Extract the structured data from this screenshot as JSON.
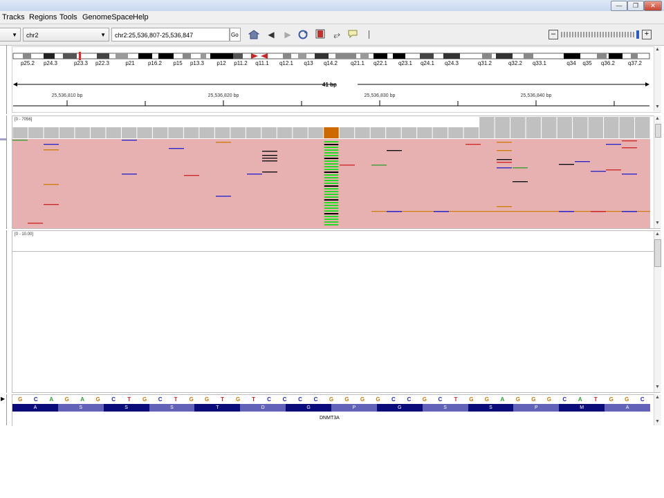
{
  "menubar": {
    "items": [
      "Tracks",
      "Regions",
      "Tools",
      "GenomeSpace",
      "Help"
    ]
  },
  "toolbar": {
    "genome_selector": "",
    "chromosome": "chr2",
    "locus": "chr2:25,536,807-25,536,847",
    "go_label": "Go",
    "icons": [
      "home-icon",
      "back-icon",
      "forward-icon",
      "refresh-icon",
      "region-of-interest-icon",
      "fit-window-icon",
      "popup-info-icon"
    ]
  },
  "window_controls": [
    "minimize-icon",
    "restore-icon",
    "close-icon"
  ],
  "ideogram": {
    "bands": [
      "p25.2",
      "p24.3",
      "p23.3",
      "p22.3",
      "p21",
      "p16.2",
      "p15",
      "p13.3",
      "p12",
      "p11.2",
      "q11.1",
      "q12.1",
      "q13",
      "q14.2",
      "q21.1",
      "q22.1",
      "q23.1",
      "q24.1",
      "q24.3",
      "q31.2",
      "q32.2",
      "q33.1",
      "q34",
      "q35",
      "q36.2",
      "q37.2"
    ]
  },
  "ruler": {
    "span_label": "41 bp",
    "coordinates": [
      "25,536,810 bp",
      "25,536,820 bp",
      "25,536,830 bp",
      "25,536,840 bp"
    ]
  },
  "coverage_track": {
    "range_label": "[0 - 7056]"
  },
  "data_track": {
    "range_label": "[0 - 10.00]"
  },
  "sequence": {
    "bases": [
      "G",
      "C",
      "A",
      "G",
      "A",
      "G",
      "C",
      "T",
      "G",
      "C",
      "T",
      "G",
      "G",
      "T",
      "G",
      "T",
      "C",
      "C",
      "C",
      "C",
      "G",
      "G",
      "G",
      "G",
      "C",
      "C",
      "G",
      "C",
      "T",
      "G",
      "G",
      "A",
      "G",
      "G",
      "G",
      "C",
      "A",
      "T",
      "G",
      "G",
      "C"
    ]
  },
  "gene_track": {
    "amino_acids": [
      "A",
      "S",
      "S",
      "S",
      "T",
      "D",
      "G",
      "P",
      "G",
      "S",
      "S",
      "P",
      "M",
      "A"
    ],
    "gene_name": "DNMT3A"
  },
  "colors": {
    "read_fill": "#e8b1b1",
    "coverage_gray": "#c0c0c0",
    "coverage_highlight": "#cc6a00",
    "mismatch_green": "#22dd22",
    "base_A": "#2e9e2e",
    "base_C": "#2222cc",
    "base_G": "#cc7a00",
    "base_T": "#cc2222",
    "aa_dark": "#0b0b7a",
    "aa_light": "#6262b8"
  }
}
